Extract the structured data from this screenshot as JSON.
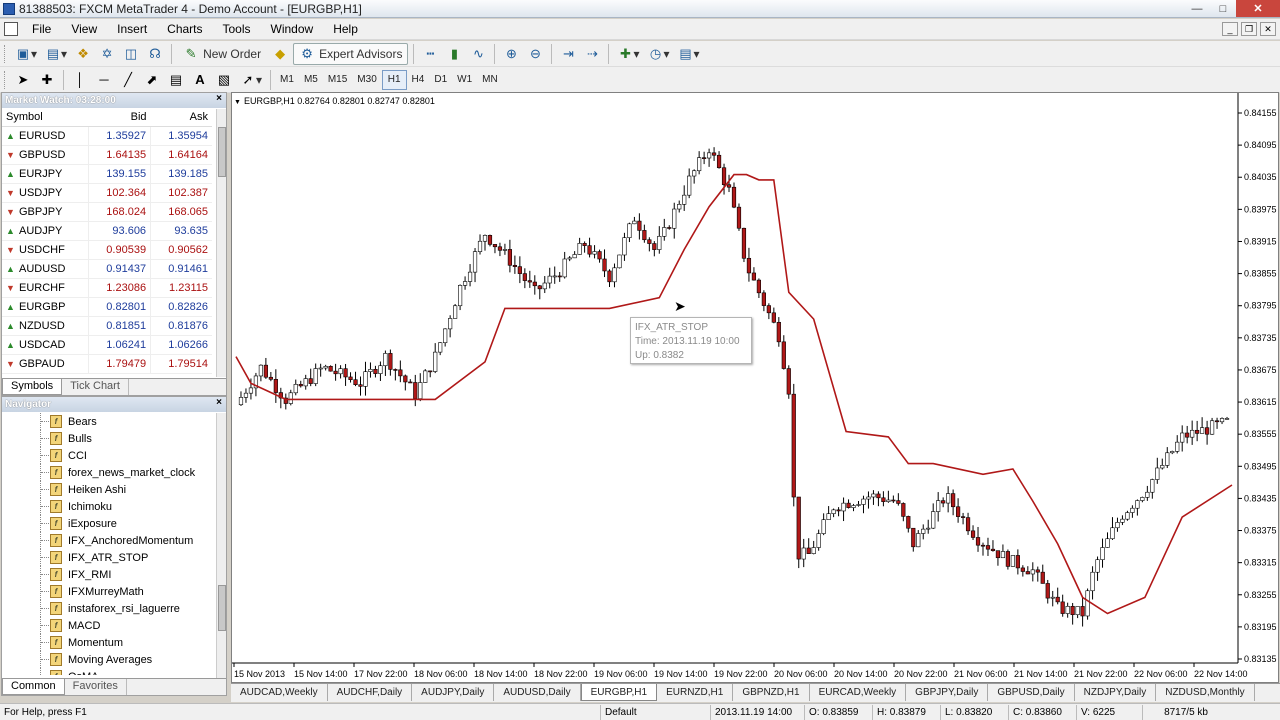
{
  "window": {
    "title": "81388503: FXCM MetaTrader 4 - Demo Account - [EURGBP,H1]"
  },
  "menu": [
    "File",
    "View",
    "Insert",
    "Charts",
    "Tools",
    "Window",
    "Help"
  ],
  "toolbar": {
    "new_order": "New Order",
    "expert_advisors": "Expert Advisors"
  },
  "timeframes": [
    "M1",
    "M5",
    "M15",
    "M30",
    "H1",
    "H4",
    "D1",
    "W1",
    "MN"
  ],
  "selected_timeframe": "H1",
  "market_watch": {
    "title": "Market Watch: 03:28:00",
    "col_symbol": "Symbol",
    "col_bid": "Bid",
    "col_ask": "Ask",
    "rows": [
      {
        "symbol": "EURUSD",
        "bid": "1.35927",
        "ask": "1.35954",
        "dir": "up"
      },
      {
        "symbol": "GBPUSD",
        "bid": "1.64135",
        "ask": "1.64164",
        "dir": "down"
      },
      {
        "symbol": "EURJPY",
        "bid": "139.155",
        "ask": "139.185",
        "dir": "up"
      },
      {
        "symbol": "USDJPY",
        "bid": "102.364",
        "ask": "102.387",
        "dir": "down"
      },
      {
        "symbol": "GBPJPY",
        "bid": "168.024",
        "ask": "168.065",
        "dir": "down"
      },
      {
        "symbol": "AUDJPY",
        "bid": "93.606",
        "ask": "93.635",
        "dir": "up"
      },
      {
        "symbol": "USDCHF",
        "bid": "0.90539",
        "ask": "0.90562",
        "dir": "down"
      },
      {
        "symbol": "AUDUSD",
        "bid": "0.91437",
        "ask": "0.91461",
        "dir": "up"
      },
      {
        "symbol": "EURCHF",
        "bid": "1.23086",
        "ask": "1.23115",
        "dir": "down"
      },
      {
        "symbol": "EURGBP",
        "bid": "0.82801",
        "ask": "0.82826",
        "dir": "up"
      },
      {
        "symbol": "NZDUSD",
        "bid": "0.81851",
        "ask": "0.81876",
        "dir": "up"
      },
      {
        "symbol": "USDCAD",
        "bid": "1.06241",
        "ask": "1.06266",
        "dir": "up"
      },
      {
        "symbol": "GBPAUD",
        "bid": "1.79479",
        "ask": "1.79514",
        "dir": "down"
      }
    ],
    "tabs": [
      "Symbols",
      "Tick Chart"
    ]
  },
  "navigator": {
    "title": "Navigator",
    "items": [
      "Bears",
      "Bulls",
      "CCI",
      "forex_news_market_clock",
      "Heiken Ashi",
      "Ichimoku",
      "iExposure",
      "IFX_AnchoredMomentum",
      "IFX_ATR_STOP",
      "IFX_RMI",
      "IFXMurreyMath",
      "instaforex_rsi_laguerre",
      "MACD",
      "Momentum",
      "Moving Averages",
      "OsMA"
    ],
    "tabs": [
      "Common",
      "Favorites"
    ]
  },
  "chart": {
    "header": "EURGBP,H1  0.82764 0.82801 0.82747 0.82801",
    "tooltip": {
      "name": "IFX_ATR_STOP",
      "time": "Time: 2013.11.19 10:00",
      "value": "Up: 0.8382"
    },
    "y_ticks": [
      "0.84155",
      "0.84095",
      "0.84035",
      "0.83975",
      "0.83915",
      "0.83855",
      "0.83795",
      "0.83735",
      "0.83675",
      "0.83615",
      "0.83555",
      "0.83495",
      "0.83435",
      "0.83375",
      "0.83315",
      "0.83255",
      "0.83195",
      "0.83135"
    ],
    "x_ticks": [
      "15 Nov 2013",
      "15 Nov 14:00",
      "17 Nov 22:00",
      "18 Nov 06:00",
      "18 Nov 14:00",
      "18 Nov 22:00",
      "19 Nov 06:00",
      "19 Nov 14:00",
      "19 Nov 22:00",
      "20 Nov 06:00",
      "20 Nov 14:00",
      "20 Nov 22:00",
      "21 Nov 06:00",
      "21 Nov 14:00",
      "21 Nov 22:00",
      "22 Nov 06:00",
      "22 Nov 14:00"
    ]
  },
  "chart_tabs": [
    "AUDCAD,Weekly",
    "AUDCHF,Daily",
    "AUDJPY,Daily",
    "AUDUSD,Daily",
    "EURGBP,H1",
    "EURNZD,H1",
    "GBPNZD,H1",
    "EURCAD,Weekly",
    "GBPJPY,Daily",
    "GBPUSD,Daily",
    "NZDJPY,Daily",
    "NZDUSD,Monthly"
  ],
  "active_chart_tab": "EURGBP,H1",
  "status": {
    "help": "For Help, press F1",
    "profile": "Default",
    "time": "2013.11.19 14:00",
    "open": "O: 0.83859",
    "high": "H: 0.83879",
    "low": "L: 0.83820",
    "close": "C: 0.83860",
    "volume": "V: 6225",
    "traffic": "8717/5 kb"
  },
  "colors": {
    "bull": "#ffffff",
    "bear": "#b01818",
    "stop_line": "#b01818",
    "axis": "#000000"
  }
}
